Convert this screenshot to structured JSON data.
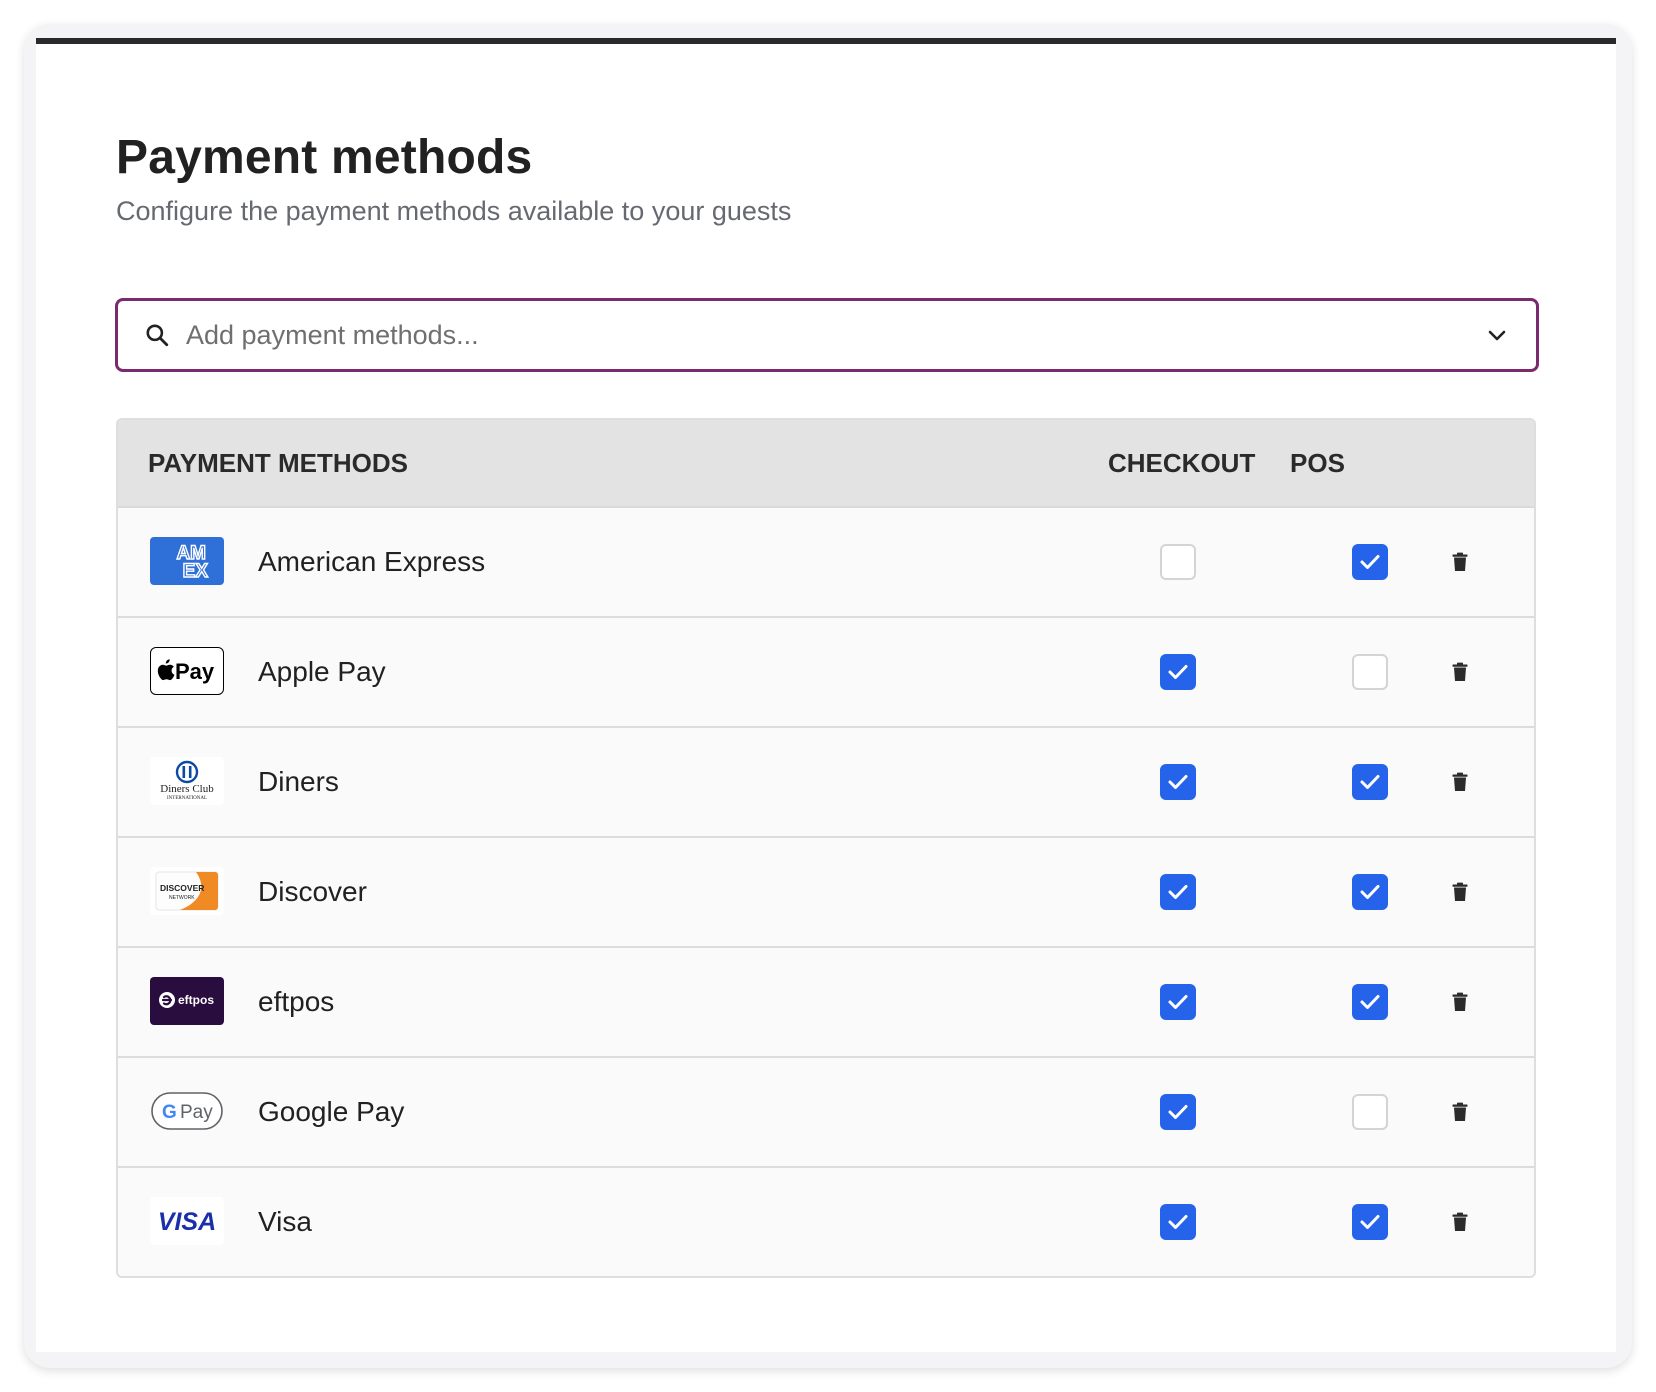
{
  "header": {
    "title": "Payment methods",
    "subtitle": "Configure the payment methods available to your guests"
  },
  "search": {
    "placeholder": "Add payment methods...",
    "value": ""
  },
  "table": {
    "columns": [
      "PAYMENT METHODS",
      "CHECKOUT",
      "POS"
    ],
    "rows": [
      {
        "name": "American Express",
        "icon": "amex-logo-icon",
        "checkout": false,
        "pos": true
      },
      {
        "name": "Apple Pay",
        "icon": "apple-pay-logo-icon",
        "checkout": true,
        "pos": false
      },
      {
        "name": "Diners",
        "icon": "diners-club-logo-icon",
        "checkout": true,
        "pos": true
      },
      {
        "name": "Discover",
        "icon": "discover-logo-icon",
        "checkout": true,
        "pos": true
      },
      {
        "name": "eftpos",
        "icon": "eftpos-logo-icon",
        "checkout": true,
        "pos": true
      },
      {
        "name": "Google Pay",
        "icon": "google-pay-logo-icon",
        "checkout": true,
        "pos": false
      },
      {
        "name": "Visa",
        "icon": "visa-logo-icon",
        "checkout": true,
        "pos": true
      }
    ]
  },
  "logos": {
    "amex": {
      "line1": "AM",
      "line2": "EX"
    },
    "apple_pay": {
      "text": "Pay"
    },
    "diners": {
      "line1": "Diners Club",
      "line2": "INTERNATIONAL"
    },
    "discover": {
      "line1": "DISCOVER",
      "line2": "NETWORK"
    },
    "eftpos": {
      "text": "eftpos"
    },
    "google_pay": {
      "g": "G",
      "text": "Pay"
    },
    "visa": {
      "text": "VISA"
    }
  },
  "colors": {
    "accent": "#2563eb",
    "search_border": "#7b2a6e",
    "card_top_border": "#2a2a2a",
    "amex_blue": "#2e6fd8",
    "eftpos_bg": "#2a0d3f",
    "visa_blue": "#1a2fa8",
    "discover_orange": "#f08a24"
  }
}
